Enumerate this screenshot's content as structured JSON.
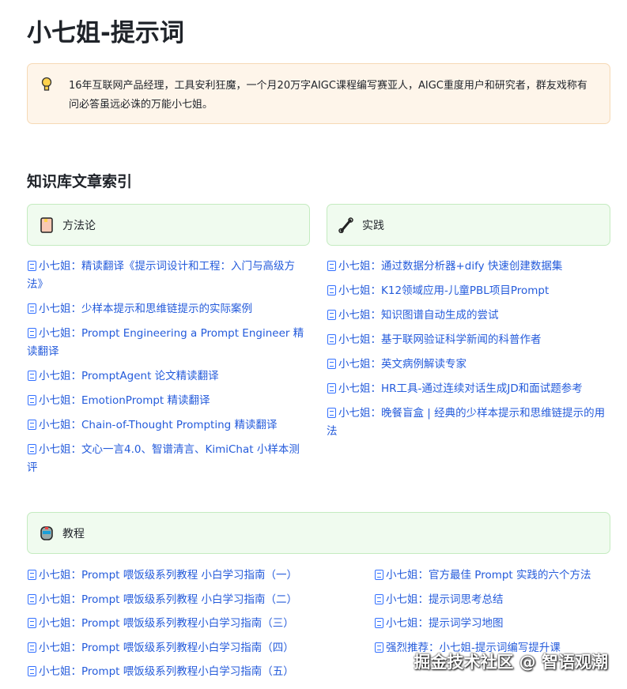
{
  "title": "小七姐-提示词",
  "callout": {
    "icon": "lightbulb-icon",
    "text": "16年互联网产品经理，工具安利狂魔，一个月20万字AIGC课程编写赛亚人，AIGC重度用户和研究者，群友戏称有问必答虽远必诛的万能小七姐。"
  },
  "section_title": "知识库文章索引",
  "cards": {
    "methodology": {
      "icon": "book-icon",
      "label": "方法论",
      "items": [
        "小七姐：精读翻译《提示词设计和工程：入门与高级方法》",
        "小七姐：少样本提示和思维链提示的实际案例",
        "小七姐：Prompt Engineering a Prompt Engineer 精读翻译",
        "小七姐：PromptAgent 论文精读翻译",
        "小七姐：EmotionPrompt 精读翻译",
        "小七姐：Chain-of-Thought Prompting 精读翻译",
        "小七姐：文心一言4.0、智谱清言、KimiChat 小样本测评"
      ]
    },
    "practice": {
      "icon": "wrench-icon",
      "label": "实践",
      "items": [
        "小七姐：通过数据分析器+dify 快速创建数据集",
        "小七姐：K12领域应用-儿童PBL项目Prompt",
        "小七姐：知识图谱自动生成的尝试",
        "小七姐：基于联网验证科学新闻的科普作者",
        "小七姐：英文病例解读专家",
        "小七姐：HR工具-通过连续对话生成JD和面试题参考",
        "小七姐：晚餐盲盒 | 经典的少样本提示和思维链提示的用法"
      ]
    },
    "tutorial": {
      "icon": "robot-icon",
      "label": "教程",
      "left": [
        "小七姐：Prompt 喂饭级系列教程  小白学习指南（一）",
        "小七姐：Prompt 喂饭级系列教程  小白学习指南（二）",
        "小七姐：Prompt 喂饭级系列教程小白学习指南（三）",
        "小七姐：Prompt 喂饭级系列教程小白学习指南（四）",
        "小七姐：Prompt 喂饭级系列教程小白学习指南（五）"
      ],
      "right": [
        "小七姐：官方最佳 Prompt 实践的六个方法",
        "小七姐：提示词思考总结",
        "小七姐：提示词学习地图",
        "强烈推荐：小七姐-提示词编写提升课"
      ]
    }
  },
  "watermark": "掘金技术社区 @ 智语观潮"
}
